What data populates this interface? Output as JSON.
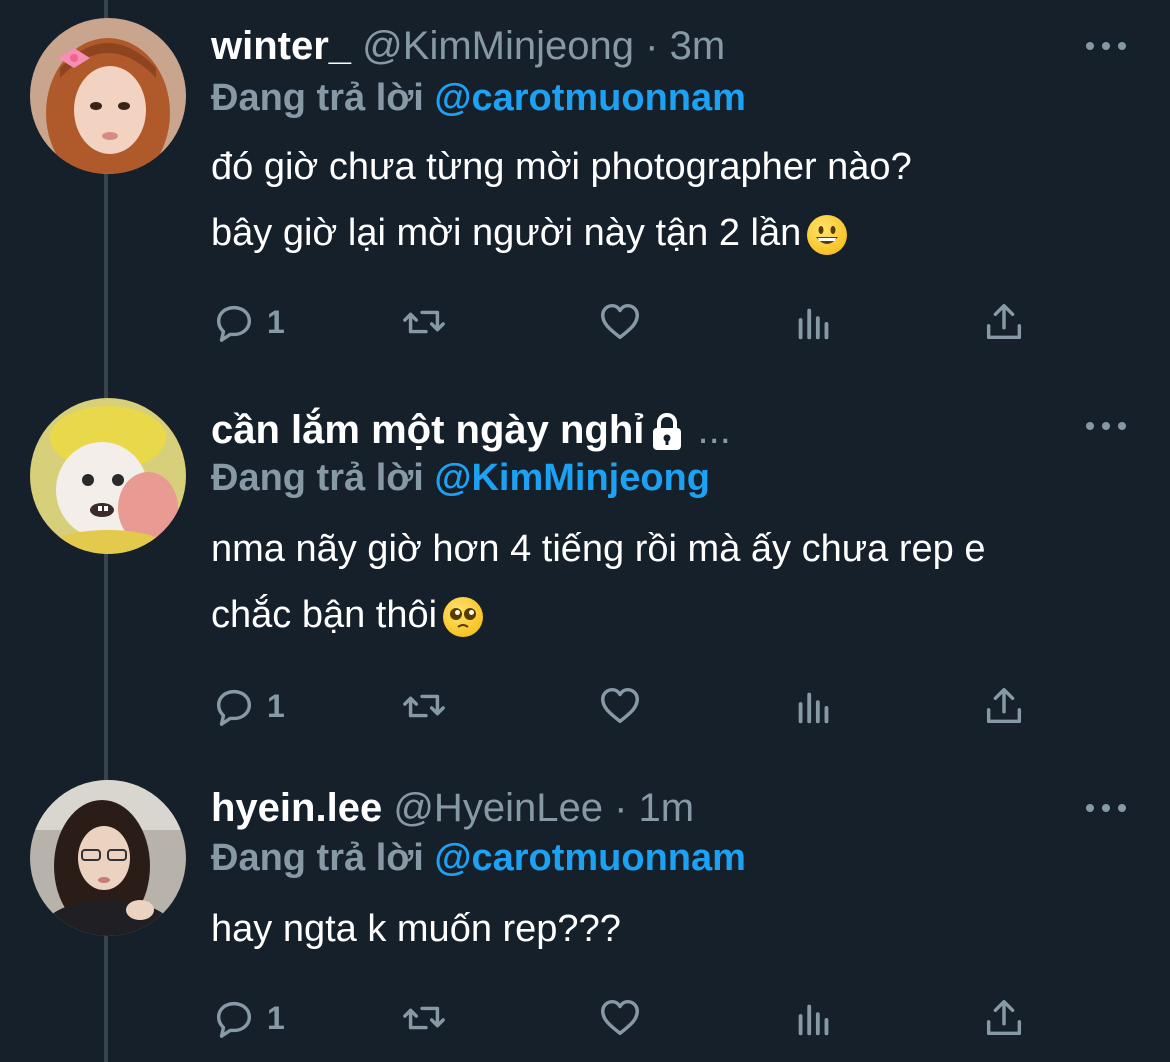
{
  "tweets": [
    {
      "display_name": "winter_",
      "handle": "@KimMinjeong",
      "separator": "·",
      "time": "3m",
      "reply_prefix": "Đang trả lời",
      "reply_to": "@carotmuonnam",
      "text_line1": "đó giờ chưa từng mời photographer nào?",
      "text_line2": "bây giờ lại mời người này tận 2 lần",
      "emoji": "grinning-face-emoji",
      "reply_count": "1",
      "avatar": "avatar-girl-pink-bow"
    },
    {
      "display_name": "cần lắm một ngày nghỉ",
      "protected_icon": "lock-icon",
      "ellipsis": "...",
      "reply_prefix": "Đang trả lời",
      "reply_to": "@KimMinjeong",
      "text_line1": "nma nãy giờ hơn 4 tiếng rồi mà ấy chưa rep e",
      "text_line2": "chắc bận thôi",
      "emoji": "pleading-face-emoji",
      "reply_count": "1",
      "avatar": "avatar-cartoon-character"
    },
    {
      "display_name": "hyein.lee",
      "handle": "@HyeinLee",
      "separator": "·",
      "time": "1m",
      "reply_prefix": "Đang trả lời",
      "reply_to": "@carotmuonnam",
      "text_line1": "hay ngta k muốn rep???",
      "reply_count": "1",
      "avatar": "avatar-girl-dark-hair"
    }
  ],
  "icons": [
    "reply-icon",
    "retweet-icon",
    "like-icon",
    "analytics-icon",
    "share-icon",
    "more-options-icon"
  ],
  "colors": {
    "background": "#15202b",
    "muted": "#8899a6",
    "link": "#1da1f2",
    "line": "#38444d"
  }
}
